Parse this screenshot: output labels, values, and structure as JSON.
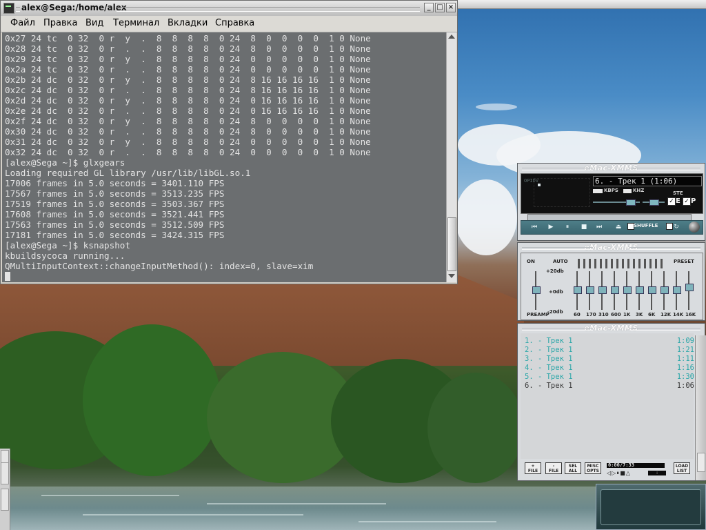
{
  "terminal": {
    "title": "alex@Sega:/home/alex",
    "menu": [
      "Файл",
      "Правка",
      "Вид",
      "Терминал",
      "Вкладки",
      "Справка"
    ],
    "lines": [
      "0x27 24 tc  0 32  0 r  y  .  8  8  8  8  0 24  8  0  0  0  0  1 0 None",
      "0x28 24 tc  0 32  0 r  .  .  8  8  8  8  0 24  8  0  0  0  0  1 0 None",
      "0x29 24 tc  0 32  0 r  y  .  8  8  8  8  0 24  0  0  0  0  0  1 0 None",
      "0x2a 24 tc  0 32  0 r  .  .  8  8  8  8  0 24  0  0  0  0  0  1 0 None",
      "0x2b 24 dc  0 32  0 r  y  .  8  8  8  8  0 24  8 16 16 16 16  1 0 None",
      "0x2c 24 dc  0 32  0 r  .  .  8  8  8  8  0 24  8 16 16 16 16  1 0 None",
      "0x2d 24 dc  0 32  0 r  y  .  8  8  8  8  0 24  0 16 16 16 16  1 0 None",
      "0x2e 24 dc  0 32  0 r  .  .  8  8  8  8  0 24  0 16 16 16 16  1 0 None",
      "0x2f 24 dc  0 32  0 r  y  .  8  8  8  8  0 24  8  0  0  0  0  1 0 None",
      "0x30 24 dc  0 32  0 r  .  .  8  8  8  8  0 24  8  0  0  0  0  1 0 None",
      "0x31 24 dc  0 32  0 r  y  .  8  8  8  8  0 24  0  0  0  0  0  1 0 None",
      "0x32 24 dc  0 32  0 r  .  .  8  8  8  8  0 24  0  0  0  0  0  1 0 None",
      "[alex@Sega ~]$ glxgears",
      "Loading required GL library /usr/lib/libGL.so.1",
      "17006 frames in 5.0 seconds = 3401.110 FPS",
      "17567 frames in 5.0 seconds = 3513.235 FPS",
      "17519 frames in 5.0 seconds = 3503.367 FPS",
      "17608 frames in 5.0 seconds = 3521.441 FPS",
      "17563 frames in 5.0 seconds = 3512.509 FPS",
      "17181 frames in 5.0 seconds = 3424.315 FPS",
      "[alex@Sega ~]$ ksnapshot",
      "kbuildsycoca running...",
      "QMultiInputContext::changeInputMethod(): index=0, slave=xim"
    ]
  },
  "xmms_main": {
    "title": "eMac-XMMS",
    "vis_letters": "OPIDV",
    "song": "6. - Трек 1 (1:06)",
    "kbps_label": "KBPS",
    "khz_label": "KHZ",
    "stereo_label": "STE",
    "toggle_e": "E",
    "toggle_p": "P",
    "shuffle_label": "SHUFFLE",
    "controls": [
      "⏮",
      "▶",
      "⏸",
      "■",
      "⏭",
      "⏏"
    ]
  },
  "xmms_eq": {
    "title": "eMac-XMMS",
    "on_label": "ON",
    "auto_label": "AUTO",
    "preset_label": "PRESET",
    "db_top": "+20db",
    "db_mid": "+0db",
    "db_bot": "-20db",
    "preamp_label": "PREAMP",
    "bands": [
      "60",
      "170",
      "310",
      "600",
      "1K",
      "3K",
      "6K",
      "12K",
      "14K",
      "16K"
    ]
  },
  "xmms_playlist": {
    "title": "eMac-XMMS",
    "tracks": [
      {
        "label": "1. - Трек 1",
        "duration": "1:09"
      },
      {
        "label": "2. - Трек 1",
        "duration": "1:21"
      },
      {
        "label": "3. - Трек 1",
        "duration": "1:11"
      },
      {
        "label": "4. - Трек 1",
        "duration": "1:16"
      },
      {
        "label": "5. - Трек 1",
        "duration": "1:30"
      },
      {
        "label": "6. - Трек 1",
        "duration": "1:06"
      }
    ],
    "buttons": {
      "add": [
        "+",
        "FILE"
      ],
      "remove": [
        "-",
        "FILE"
      ],
      "select": [
        "SEL",
        "ALL"
      ],
      "misc": [
        "MISC",
        "OPTS"
      ],
      "list": [
        "LOAD",
        "LIST"
      ]
    },
    "time_display": "0:00/7:33",
    "mini_controls": "◁▷⏸■△"
  },
  "colors": {
    "playlist_text": "#2aa6a8",
    "playlist_current": "#3a3a3a",
    "xmms_accent": "#7fb3bb"
  }
}
